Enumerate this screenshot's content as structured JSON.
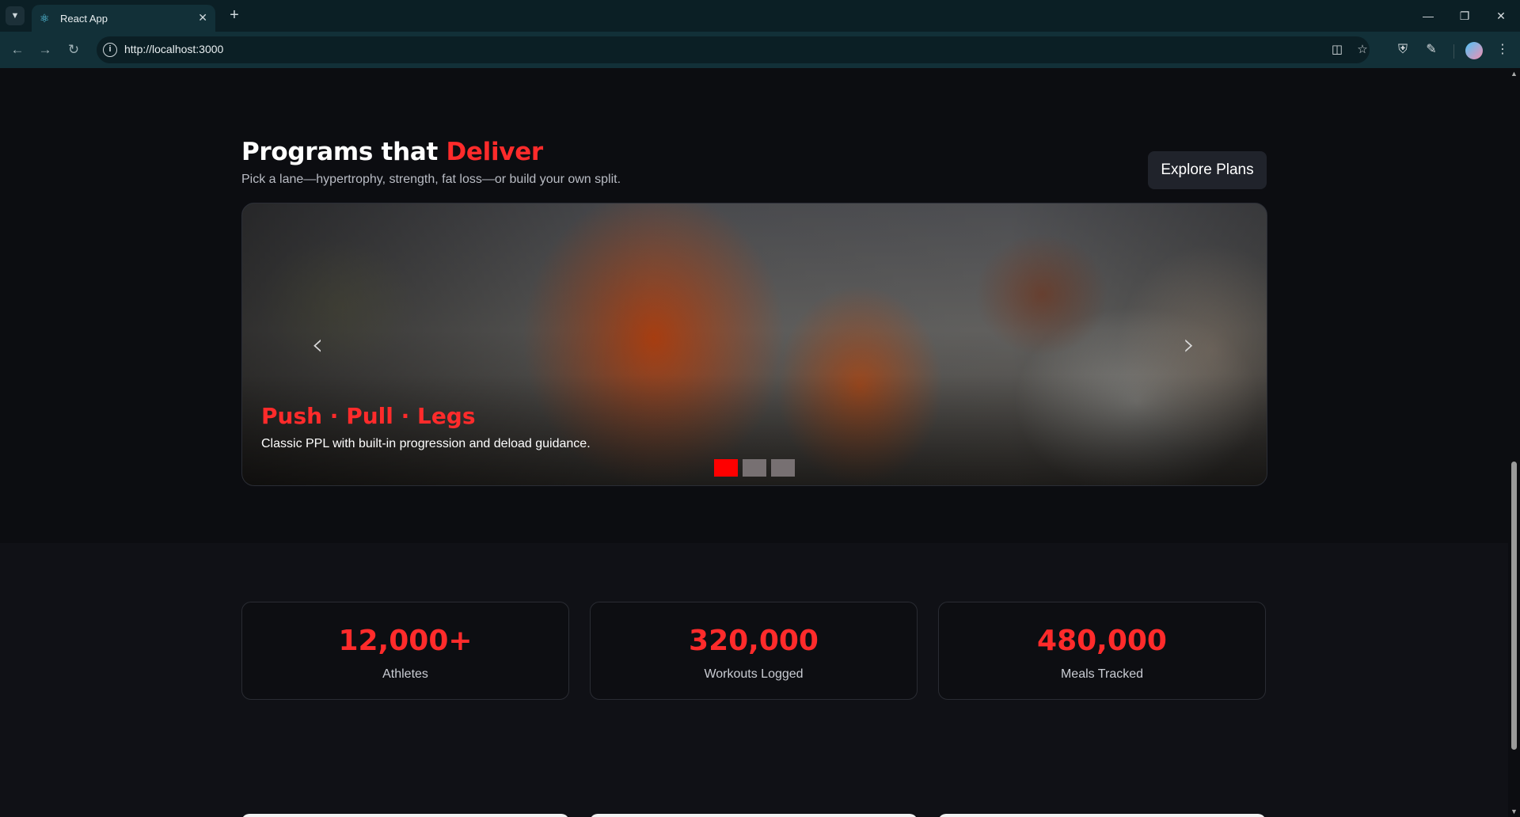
{
  "browser": {
    "tab_title": "React App",
    "url": "http://localhost:3000"
  },
  "section": {
    "title_main": "Programs that",
    "title_accent": "Deliver",
    "subtitle": "Pick a lane—hypertrophy, strength, fat loss—or build your own split.",
    "cta_label": "Explore Plans"
  },
  "carousel": {
    "slide_title": "Push · Pull · Legs",
    "slide_description": "Classic PPL with built-in progression and deload guidance.",
    "slide_count": 3,
    "active_index": 0
  },
  "stats": [
    {
      "value": "12,000+",
      "label": "Athletes"
    },
    {
      "value": "320,000",
      "label": "Workouts Logged"
    },
    {
      "value": "480,000",
      "label": "Meals Tracked"
    }
  ],
  "colors": {
    "accent": "#ff2b2b",
    "background": "#0c0d11"
  }
}
